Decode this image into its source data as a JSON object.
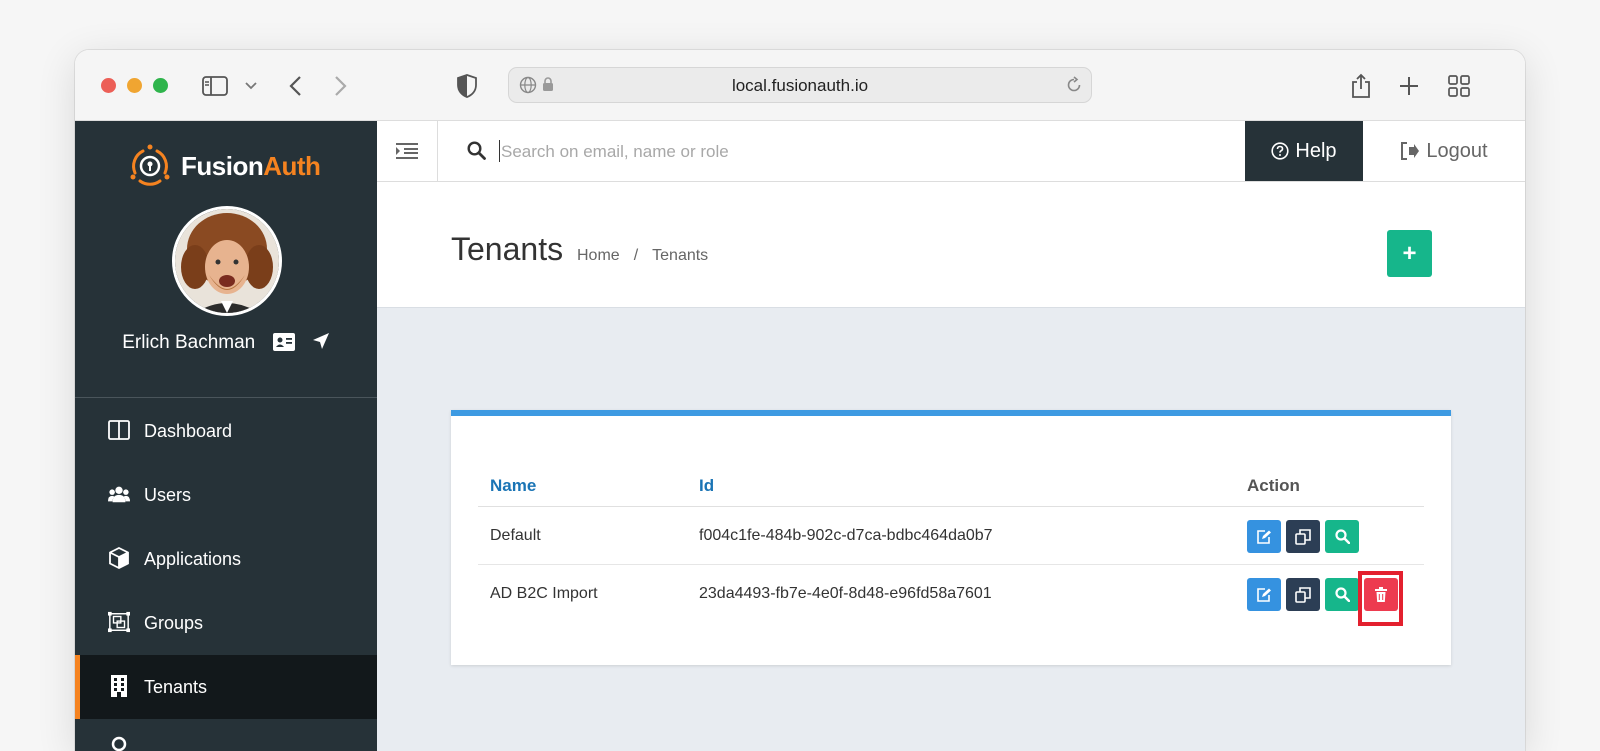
{
  "browser": {
    "url": "local.fusionauth.io"
  },
  "brand": {
    "name_main": "Fusion",
    "name_accent": "Auth",
    "accent_color": "#f58320"
  },
  "user": {
    "name": "Erlich Bachman"
  },
  "sidebar": {
    "items": [
      {
        "label": "Dashboard",
        "icon": "columns-icon"
      },
      {
        "label": "Users",
        "icon": "users-icon"
      },
      {
        "label": "Applications",
        "icon": "cube-icon"
      },
      {
        "label": "Groups",
        "icon": "object-group-icon"
      },
      {
        "label": "Tenants",
        "icon": "building-icon",
        "active": true
      }
    ]
  },
  "topbar": {
    "search_placeholder": "Search on email, name or role",
    "help_label": "Help",
    "logout_label": "Logout"
  },
  "page": {
    "title": "Tenants",
    "breadcrumb": [
      "Home",
      "/",
      "Tenants"
    ],
    "add_label": "+"
  },
  "table": {
    "columns": [
      "Name",
      "Id",
      "Action"
    ],
    "rows": [
      {
        "name": "Default",
        "id": "f004c1fe-484b-902c-d7ca-bdbc464da0b7",
        "actions": [
          "edit",
          "duplicate",
          "view"
        ]
      },
      {
        "name": "AD B2C Import",
        "id": "23da4493-fb7e-4e0f-8d48-e96fd58a7601",
        "actions": [
          "edit",
          "duplicate",
          "view",
          "delete"
        ]
      }
    ]
  }
}
